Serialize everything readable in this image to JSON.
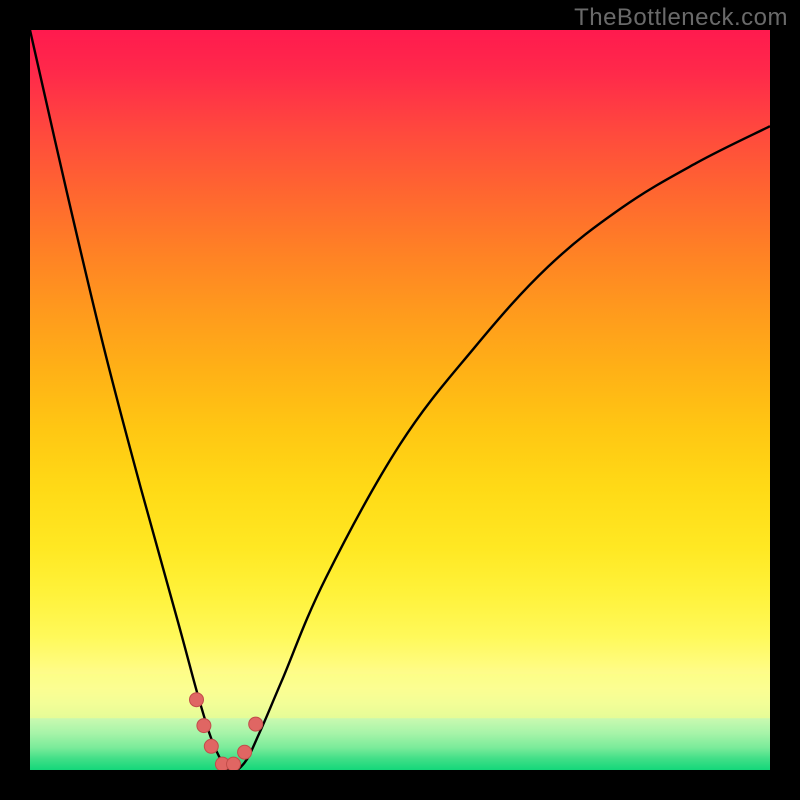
{
  "watermark": "TheBottleneck.com",
  "colors": {
    "frame_bg": "#000000",
    "curve": "#000000",
    "marker_fill": "#e06663",
    "marker_stroke": "#c24d4a",
    "highlight_band": "#fcff84"
  },
  "chart_data": {
    "type": "line",
    "title": "",
    "xlabel": "",
    "ylabel": "",
    "xlim": [
      0,
      1
    ],
    "ylim": [
      0,
      100
    ],
    "notes": "Gradient background maps bottleneck severity: ~0 (green, bottom) to 100 (red, top). Black curve shows relative bottleneck vs component balance; minimum near x≈0.27 touches 0.",
    "series": [
      {
        "name": "bottleneck-curve",
        "x": [
          0.0,
          0.05,
          0.1,
          0.15,
          0.2,
          0.23,
          0.25,
          0.27,
          0.29,
          0.31,
          0.34,
          0.4,
          0.5,
          0.6,
          0.7,
          0.8,
          0.9,
          1.0
        ],
        "y": [
          100,
          78,
          57,
          38,
          20,
          9,
          3,
          0,
          1,
          5,
          12,
          26,
          44,
          57,
          68,
          76,
          82,
          87
        ]
      }
    ],
    "markers": {
      "name": "highlight-points",
      "x": [
        0.225,
        0.235,
        0.245,
        0.26,
        0.275,
        0.29,
        0.305
      ],
      "y": [
        9.5,
        6.0,
        3.2,
        0.8,
        0.8,
        2.4,
        6.2
      ]
    },
    "highlight_band_y": [
      7,
      13
    ]
  }
}
